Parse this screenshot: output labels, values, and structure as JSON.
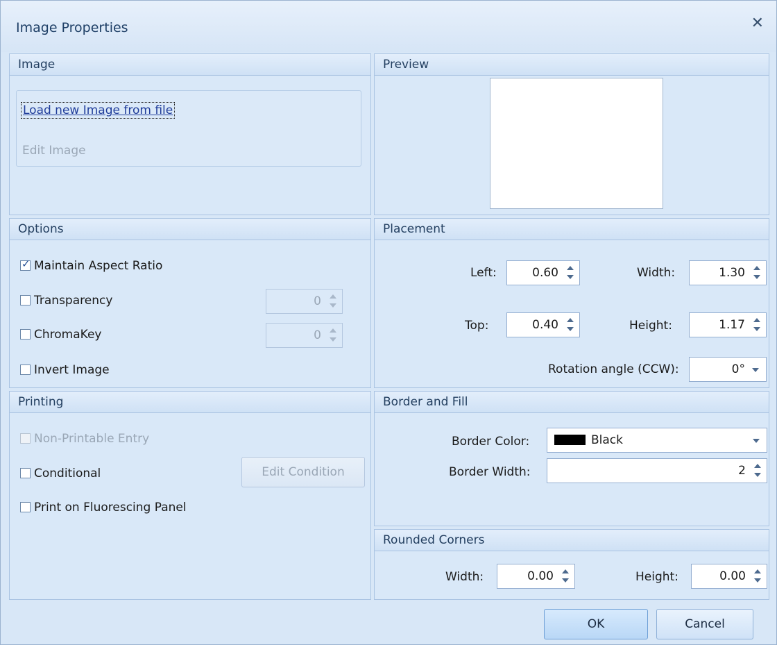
{
  "dialog": {
    "title": "Image Properties"
  },
  "image_panel": {
    "header": "Image",
    "load_link": "Load new Image from file",
    "edit_link": "Edit Image"
  },
  "preview_panel": {
    "header": "Preview"
  },
  "options_panel": {
    "header": "Options",
    "maintain_aspect": {
      "label": "Maintain Aspect Ratio",
      "checked": true
    },
    "transparency": {
      "label": "Transparency",
      "checked": false,
      "value": "0"
    },
    "chromakey": {
      "label": "ChromaKey",
      "checked": false,
      "value": "0"
    },
    "invert": {
      "label": "Invert Image",
      "checked": false
    }
  },
  "placement_panel": {
    "header": "Placement",
    "left": {
      "label": "Left:",
      "value": "0.60"
    },
    "width": {
      "label": "Width:",
      "value": "1.30"
    },
    "top": {
      "label": "Top:",
      "value": "0.40"
    },
    "height": {
      "label": "Height:",
      "value": "1.17"
    },
    "rotation": {
      "label": "Rotation angle (CCW):",
      "value": "0°"
    }
  },
  "printing_panel": {
    "header": "Printing",
    "non_printable": {
      "label": "Non-Printable Entry",
      "checked": false
    },
    "conditional": {
      "label": "Conditional",
      "checked": false
    },
    "edit_condition": "Edit Condition",
    "fluorescing": {
      "label": "Print on Fluorescing Panel",
      "checked": false
    }
  },
  "border_panel": {
    "header": "Border and Fill",
    "color_label": "Border Color:",
    "color_value": "Black",
    "color_hex": "#000000",
    "width_label": "Border Width:",
    "width_value": "2"
  },
  "corners_panel": {
    "header": "Rounded Corners",
    "width_label": "Width:",
    "width_value": "0.00",
    "height_label": "Height:",
    "height_value": "0.00"
  },
  "footer": {
    "ok": "OK",
    "cancel": "Cancel"
  }
}
